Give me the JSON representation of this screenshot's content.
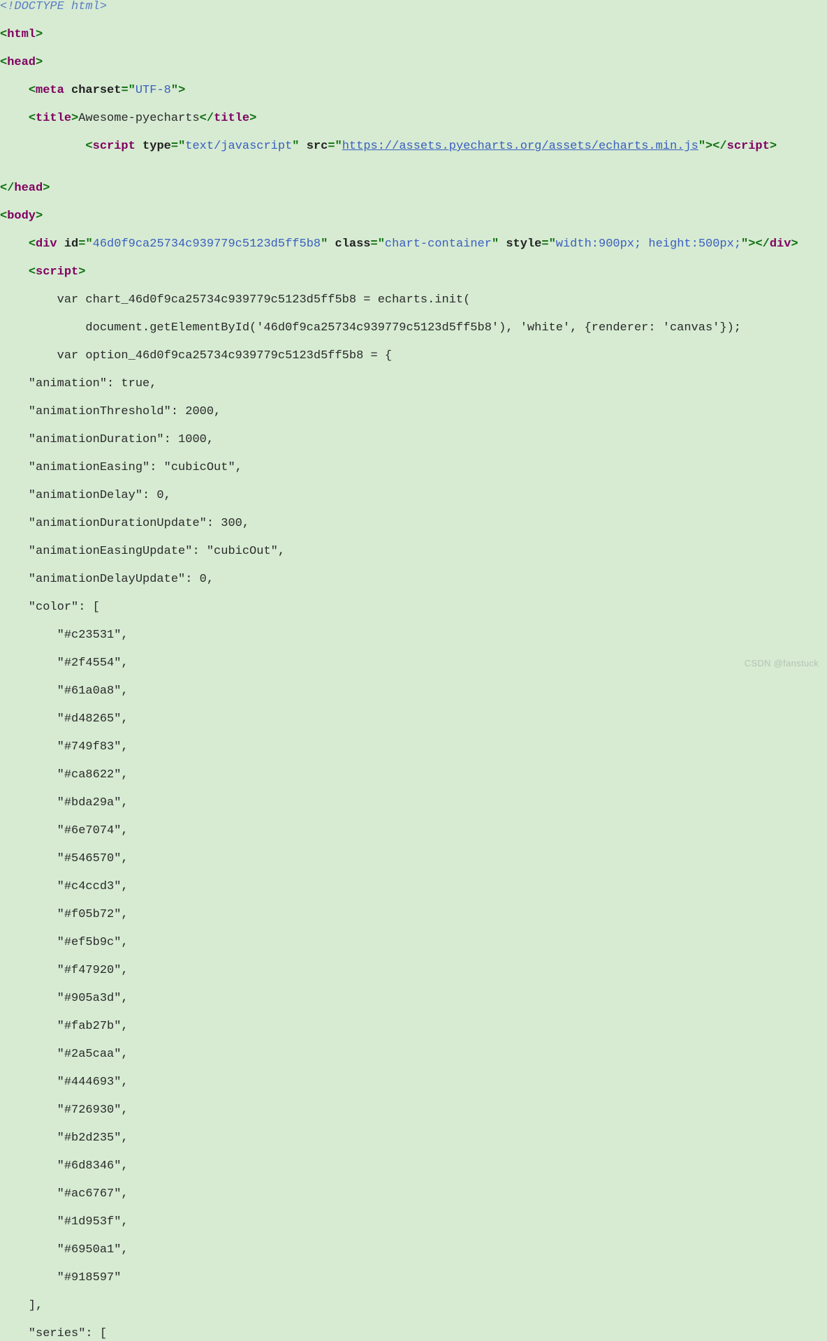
{
  "doctype": "<!DOCTYPE html>",
  "tags": {
    "html": "html",
    "head": "head",
    "body": "body",
    "meta": "meta",
    "title": "title",
    "script": "script",
    "div": "div"
  },
  "attrs": {
    "charset": "charset",
    "type": "type",
    "src": "src",
    "id": "id",
    "class": "class",
    "style": "style"
  },
  "vals": {
    "utf8": "UTF-8",
    "text_js": "text/javascript",
    "echarts_url": "https://assets.pyecharts.org/assets/echarts.min.js",
    "chart_id": "46d0f9ca25734c939779c5123d5ff5b8",
    "chart_class": "chart-container",
    "chart_style": "width:900px; height:500px;"
  },
  "title_text": "Awesome-pyecharts",
  "script_body": {
    "init_line1": "        var chart_46d0f9ca25734c939779c5123d5ff5b8 = echarts.init(",
    "init_line2": "            document.getElementById('46d0f9ca25734c939779c5123d5ff5b8'), 'white', {renderer: 'canvas'});",
    "opt_decl": "        var option_46d0f9ca25734c939779c5123d5ff5b8 = {"
  },
  "options": {
    "animation": "true",
    "animationThreshold": "2000",
    "animationDuration": "1000",
    "animationEasing": "\"cubicOut\"",
    "animationDelay": "0",
    "animationDurationUpdate": "300",
    "animationEasingUpdate": "\"cubicOut\"",
    "animationDelayUpdate": "0"
  },
  "color_key": "    \"color\": [",
  "colors": [
    "#c23531",
    "#2f4554",
    "#61a0a8",
    "#d48265",
    "#749f83",
    "#ca8622",
    "#bda29a",
    "#6e7074",
    "#546570",
    "#c4ccd3",
    "#f05b72",
    "#ef5b9c",
    "#f47920",
    "#905a3d",
    "#fab27b",
    "#2a5caa",
    "#444693",
    "#726930",
    "#b2d235",
    "#6d8346",
    "#ac6767",
    "#1d953f",
    "#6950a1",
    "#918597"
  ],
  "color_close": "    ],",
  "series_start": "    \"series\": [",
  "watermark": "CSDN @fanstuck"
}
